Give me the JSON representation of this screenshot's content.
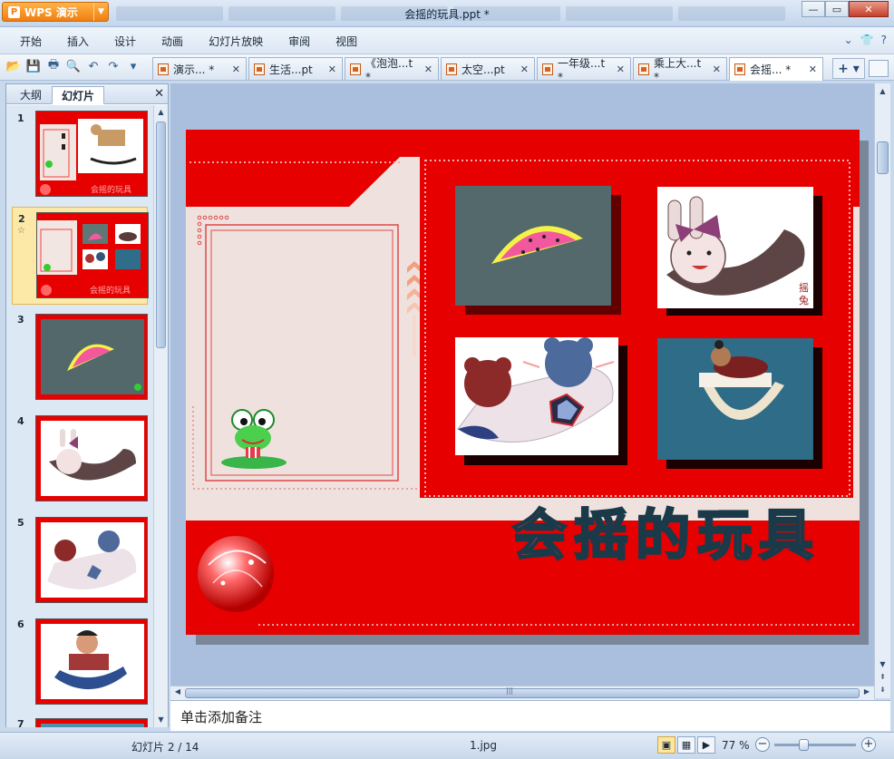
{
  "app": {
    "brand": "WPS 演示",
    "document_title": "会摇的玩具.ppt *"
  },
  "window_controls": {
    "minimize": "—",
    "restore": "▭",
    "close": "✕"
  },
  "menu": [
    "开始",
    "插入",
    "设计",
    "动画",
    "幻灯片放映",
    "审阅",
    "视图"
  ],
  "menu_right": {
    "dropdown": "⌄",
    "skin": "👕",
    "help": "?"
  },
  "doc_tabs": [
    {
      "label": "演示... *"
    },
    {
      "label": "生活...pt"
    },
    {
      "label": "《泡泡...t *"
    },
    {
      "label": "太空...pt"
    },
    {
      "label": "一年级...t *"
    },
    {
      "label": "乘上大...t *"
    },
    {
      "label": "会摇... *"
    }
  ],
  "panel": {
    "tab_outline": "大纲",
    "tab_slides": "幻灯片",
    "close": "✕",
    "thumbnails": [
      {
        "num": "1"
      },
      {
        "num": "2",
        "selected": true
      },
      {
        "num": "3"
      },
      {
        "num": "4"
      },
      {
        "num": "5"
      },
      {
        "num": "6"
      },
      {
        "num": "7"
      }
    ]
  },
  "slide": {
    "title": "会摇的玩具",
    "seal_text_1": "摇",
    "seal_text_2": "兔"
  },
  "notes_placeholder": "单击添加备注",
  "status": {
    "position": "幻灯片 2 / 14",
    "filename": "1.jpg",
    "zoom": "77 %",
    "zoom_fraction": 0.35
  },
  "colors": {
    "slide_red": "#e60000",
    "panel_bg": "#dde8f5",
    "selection": "#fde9a7",
    "workspace": "#a9bfdd"
  }
}
